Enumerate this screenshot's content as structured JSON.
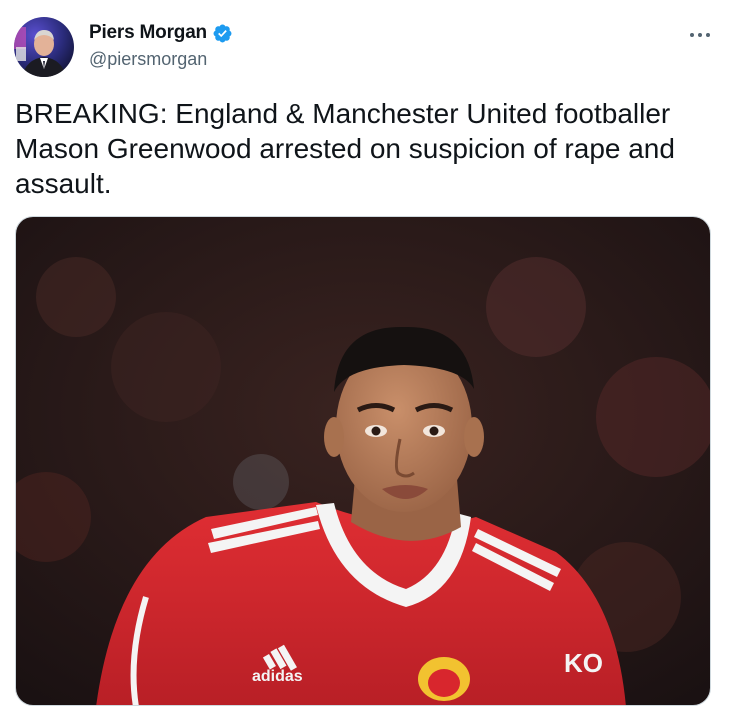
{
  "tweet": {
    "author": {
      "display_name": "Piers Morgan",
      "handle": "@piersmorgan",
      "verified": true,
      "avatar_icon": "profile-photo"
    },
    "more_icon": "ellipsis-icon",
    "text": "BREAKING: England & Manchester United footballer Mason Greenwood arrested on suspicion of rape and assault.",
    "media": {
      "kind": "photo",
      "shirt_texts": [
        "adidas",
        "KO"
      ]
    }
  },
  "colors": {
    "verified_blue": "#1d9bf0",
    "text": "#0f1419",
    "secondary_text": "#536471",
    "kit_red": "#d8262d"
  }
}
